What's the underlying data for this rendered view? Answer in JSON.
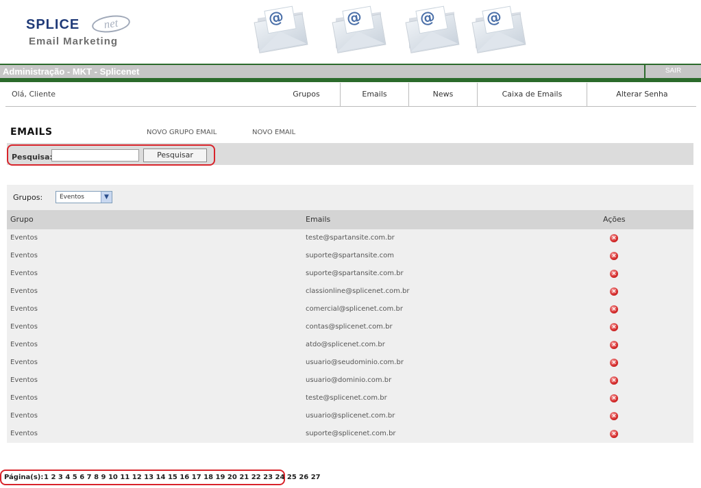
{
  "header": {
    "logo_main": "SPLICE",
    "logo_net": "net",
    "logo_sub": "Email Marketing",
    "envelope_icon": "@"
  },
  "adminbar": {
    "title": "Administração - MKT - Splicenet",
    "logout": "SAIR"
  },
  "nav": {
    "greeting": "Olá, Cliente",
    "items": [
      "Grupos",
      "Emails",
      "News",
      "Caixa de Emails",
      "Alterar Senha"
    ]
  },
  "section": {
    "title": "EMAILS",
    "new_group_link": "NOVO GRUPO EMAIL",
    "new_email_link": "NOVO EMAIL"
  },
  "search": {
    "label": "Pesquisa:",
    "value": "",
    "button": "Pesquisar"
  },
  "filter": {
    "label": "Grupos:",
    "selected": "Eventos"
  },
  "table": {
    "columns": [
      "Grupo",
      "Emails",
      "Ações"
    ],
    "rows": [
      {
        "grupo": "Eventos",
        "email": "teste@spartansite.com.br"
      },
      {
        "grupo": "Eventos",
        "email": "suporte@spartansite.com"
      },
      {
        "grupo": "Eventos",
        "email": "suporte@spartansite.com.br"
      },
      {
        "grupo": "Eventos",
        "email": "classionline@splicenet.com.br"
      },
      {
        "grupo": "Eventos",
        "email": "comercial@splicenet.com.br"
      },
      {
        "grupo": "Eventos",
        "email": "contas@splicenet.com.br"
      },
      {
        "grupo": "Eventos",
        "email": "atdo@splicenet.com.br"
      },
      {
        "grupo": "Eventos",
        "email": "usuario@seudominio.com.br"
      },
      {
        "grupo": "Eventos",
        "email": "usuario@dominio.com.br"
      },
      {
        "grupo": "Eventos",
        "email": "teste@splicenet.com.br"
      },
      {
        "grupo": "Eventos",
        "email": "usuario@splicenet.com.br"
      },
      {
        "grupo": "Eventos",
        "email": "suporte@splicenet.com.br"
      }
    ]
  },
  "pagination": {
    "label": "Página(s):",
    "pages": "1 2 3 4 5 6 7 8 9 10 11 12 13 14 15 16 17 18 19 20 21 22 23 24 25 26 27"
  }
}
